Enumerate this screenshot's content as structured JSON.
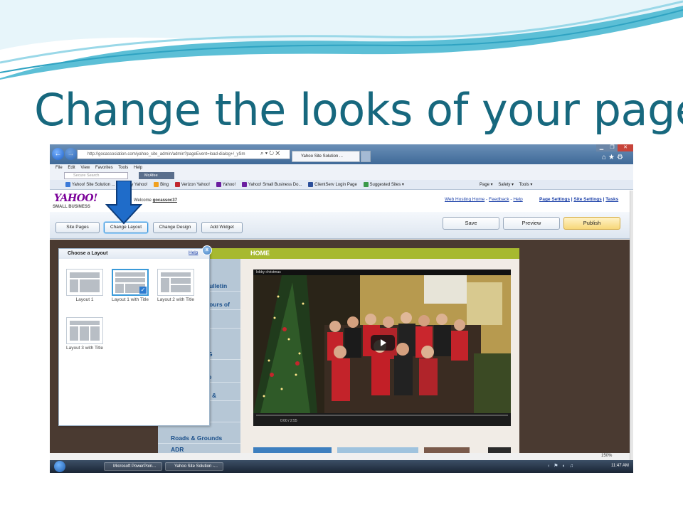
{
  "slide": {
    "title": "Change the looks of your page"
  },
  "browser": {
    "address": "http://gocassociation.com/yahoo_site_admin/admin?pageEvent=load-dialog+/_ySm",
    "tab_title": "Yahoo Site Solution ...",
    "menu": [
      "File",
      "Edit",
      "View",
      "Favorites",
      "Tools",
      "Help"
    ],
    "search_placeholder": "Secure Search",
    "mcafee_label": "McAfee",
    "favorites": [
      {
        "label": "Yahoo! Site Solution ...",
        "color": "#3b7ad8"
      },
      {
        "label": "My Yahoo!",
        "color": "#6b1fa0"
      },
      {
        "label": "Bing",
        "color": "#f0a020"
      },
      {
        "label": "Verizon Yahoo!",
        "color": "#c0262e"
      },
      {
        "label": "Yahoo!",
        "color": "#6b1fa0"
      },
      {
        "label": "Yahoo! Small Business Do...",
        "color": "#6b1fa0"
      },
      {
        "label": "ClientServ Login Page",
        "color": "#2b4f9a"
      },
      {
        "label": "Suggested Sites ▾",
        "color": "#3b9a4a"
      }
    ],
    "command_bar": [
      "Page ▾",
      "Safety ▾",
      "Tools ▾"
    ],
    "zoom": "150%"
  },
  "builder": {
    "logo": "YAHOO!",
    "logo_sub": "SMALL BUSINESS",
    "welcome_prefix": "Welcome",
    "username": "gocassoc37",
    "header_links": [
      "Web Hosting Home",
      "Feedback",
      "Help"
    ],
    "site_links": [
      "Page Settings",
      "Site Settings",
      "Tasks"
    ],
    "tabs": [
      "Site Pages",
      "Change Layout",
      "Change Design",
      "Add Widget"
    ],
    "actions": [
      "Save",
      "Preview",
      "Publish"
    ],
    "colors": {
      "accent": "#a7b92f",
      "background": "#4a3a31",
      "nav": "#b6c7d6"
    }
  },
  "page_preview": {
    "heading": "HOME",
    "nav_items": [
      "Bulletin",
      "Hours of",
      "",
      "G",
      "ee",
      "&",
      "",
      "Roads & Grounds",
      "ADR"
    ],
    "video_title": "lobby christmas",
    "video_time": "0:00 / 2:55",
    "video_progress": 0.0
  },
  "layout_dialog": {
    "title": "Choose a Layout",
    "help": "Help",
    "close_icon": "x",
    "options": [
      {
        "label": "Layout 1",
        "selected": false
      },
      {
        "label": "Layout 1 with Title",
        "selected": true
      },
      {
        "label": "Layout 2 with Title",
        "selected": false
      },
      {
        "label": "Layout 3 with Title",
        "selected": false
      }
    ]
  },
  "taskbar": {
    "items": [
      "Microsoft PowerPoin...",
      "Yahoo Site Solution -..."
    ],
    "clock": "11:47 AM"
  }
}
